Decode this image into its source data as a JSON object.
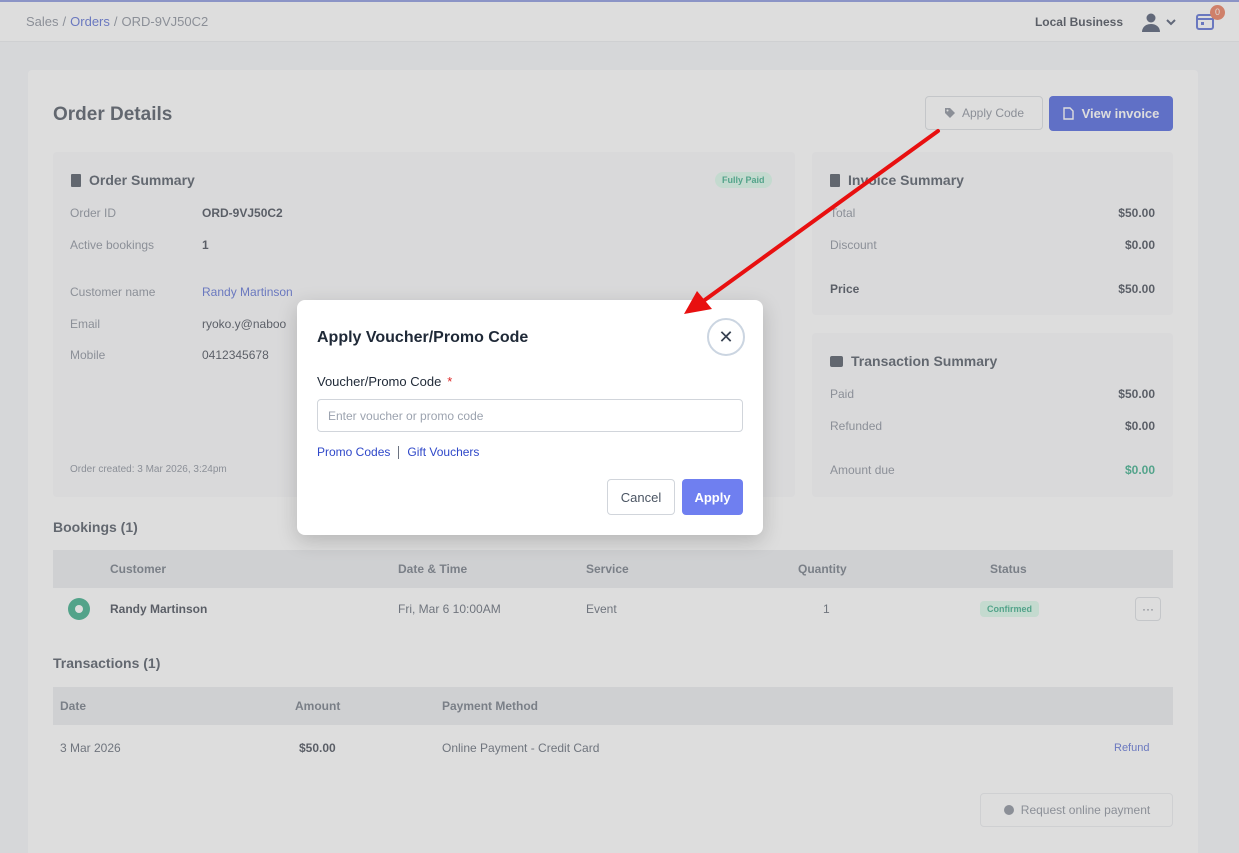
{
  "breadcrumb": {
    "sales": "Sales",
    "sep1": "/",
    "orders": "Orders",
    "sep2": "/",
    "current": "ORD-9VJ50C2"
  },
  "topbar": {
    "business": "Local Business",
    "notification_count": "0"
  },
  "page": {
    "title": "Order Details",
    "apply_code_label": "Apply Code",
    "view_invoice_label": "View invoice"
  },
  "order_summary": {
    "title": "Order Summary",
    "status": "Fully Paid",
    "order_id_label": "Order ID",
    "order_id": "ORD-9VJ50C2",
    "active_bookings_label": "Active bookings",
    "active_bookings": "1",
    "customer_name_label": "Customer name",
    "customer_name": "Randy Martinson",
    "email_label": "Email",
    "email": "ryoko.y@naboo",
    "mobile_label": "Mobile",
    "mobile": "0412345678",
    "created": "Order created: 3 Mar 2026, 3:24pm"
  },
  "invoice_summary": {
    "title": "Invoice Summary",
    "total_label": "Total",
    "total": "$50.00",
    "discount_label": "Discount",
    "discount": "$0.00",
    "price_label": "Price",
    "price": "$50.00"
  },
  "transaction_summary": {
    "title": "Transaction Summary",
    "paid_label": "Paid",
    "paid": "$50.00",
    "refunded_label": "Refunded",
    "refunded": "$0.00",
    "amount_due_label": "Amount due",
    "amount_due": "$0.00"
  },
  "bookings": {
    "title": "Bookings (1)",
    "headers": [
      "Customer",
      "Date & Time",
      "Service",
      "Quantity",
      "Status"
    ],
    "rows": [
      {
        "customer": "Randy Martinson",
        "datetime": "Fri, Mar 6 10:00AM",
        "service": "Event",
        "quantity": "1",
        "status": "Confirmed",
        "more": "···"
      }
    ]
  },
  "transactions": {
    "title": "Transactions (1)",
    "headers": [
      "Date",
      "Amount",
      "Payment Method"
    ],
    "rows": [
      {
        "date": "3 Mar 2026",
        "amount": "$50.00",
        "method": "Online Payment - Credit Card",
        "action": "Refund"
      }
    ],
    "request_payment": "Request online payment"
  },
  "modal": {
    "title": "Apply Voucher/Promo Code",
    "close": "✕",
    "field_label": "Voucher/Promo Code",
    "required_mark": "*",
    "placeholder": "Enter voucher or promo code",
    "value": "",
    "link_promo": "Promo Codes",
    "link_gift": "Gift Vouchers",
    "cancel": "Cancel",
    "apply": "Apply"
  },
  "colors": {
    "primary": "#1d39d6",
    "apply_button": "#6f7ff0",
    "annotation_arrow": "#e81010",
    "success": "#059669"
  }
}
